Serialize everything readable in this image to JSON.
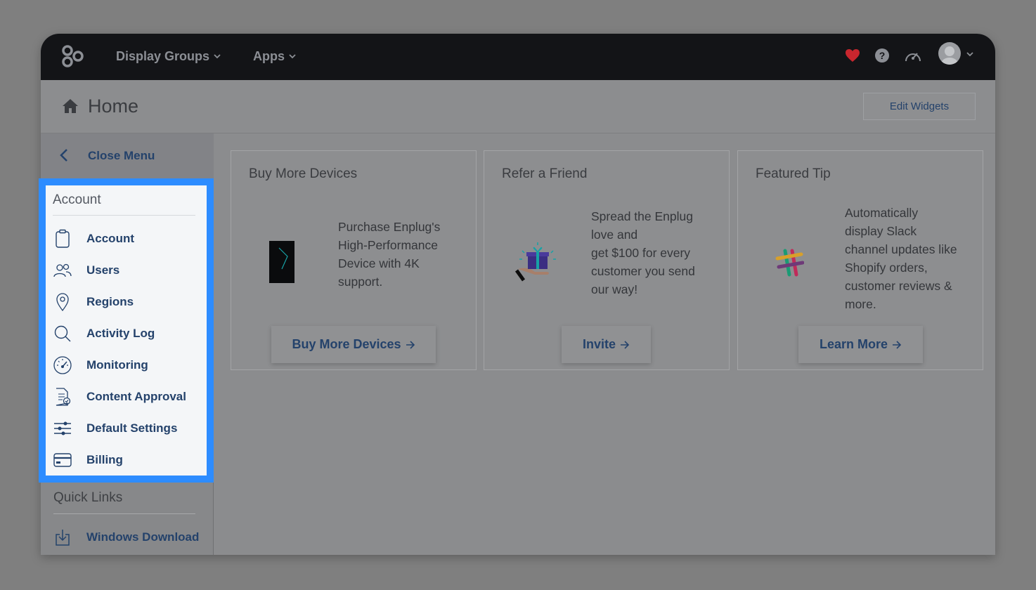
{
  "topbar": {
    "nav": [
      {
        "label": "Display Groups",
        "icon": "chevron-down-icon"
      },
      {
        "label": "Apps",
        "icon": "chevron-down-icon"
      }
    ],
    "icons": [
      "enplug-logo-icon",
      "heart-icon",
      "help-icon",
      "dashboard-gauge-icon",
      "user-avatar",
      "chevron-down-icon"
    ]
  },
  "header": {
    "title": "Home",
    "edit_widgets": "Edit Widgets"
  },
  "sidebar": {
    "close_menu": "Close Menu",
    "account": {
      "title": "Account",
      "items": [
        {
          "label": "Account",
          "icon": "clipboard-icon"
        },
        {
          "label": "Users",
          "icon": "users-icon"
        },
        {
          "label": "Regions",
          "icon": "map-pin-icon"
        },
        {
          "label": "Activity Log",
          "icon": "search-icon"
        },
        {
          "label": "Monitoring",
          "icon": "gauge-icon"
        },
        {
          "label": "Content Approval",
          "icon": "document-check-icon"
        },
        {
          "label": "Default Settings",
          "icon": "sliders-icon"
        },
        {
          "label": "Billing",
          "icon": "credit-card-icon"
        }
      ]
    },
    "quick_links": {
      "title": "Quick Links",
      "items": [
        {
          "label": "Windows Download",
          "icon": "download-icon"
        }
      ]
    }
  },
  "cards": [
    {
      "title": "Buy More Devices",
      "text_lines": [
        "Purchase Enplug's",
        "High-Performance",
        "Device with 4K",
        "support."
      ],
      "button": "Buy More Devices",
      "icon": "display-device-icon"
    },
    {
      "title": "Refer a Friend",
      "text_lines": [
        "Spread the Enplug",
        "love and",
        "get $100 for every",
        "customer you send",
        "our way!"
      ],
      "button": "Invite",
      "icon": "gift-icon"
    },
    {
      "title": "Featured Tip",
      "text_lines": [
        "Automatically",
        "display Slack",
        "channel updates like",
        "Shopify orders,",
        "customer reviews &",
        "more."
      ],
      "button": "Learn More",
      "icon": "slack-logo-icon"
    }
  ],
  "colors": {
    "highlight": "#2d8cff",
    "link": "#24426b",
    "topbar": "#131417",
    "heart": "#c8262e"
  }
}
